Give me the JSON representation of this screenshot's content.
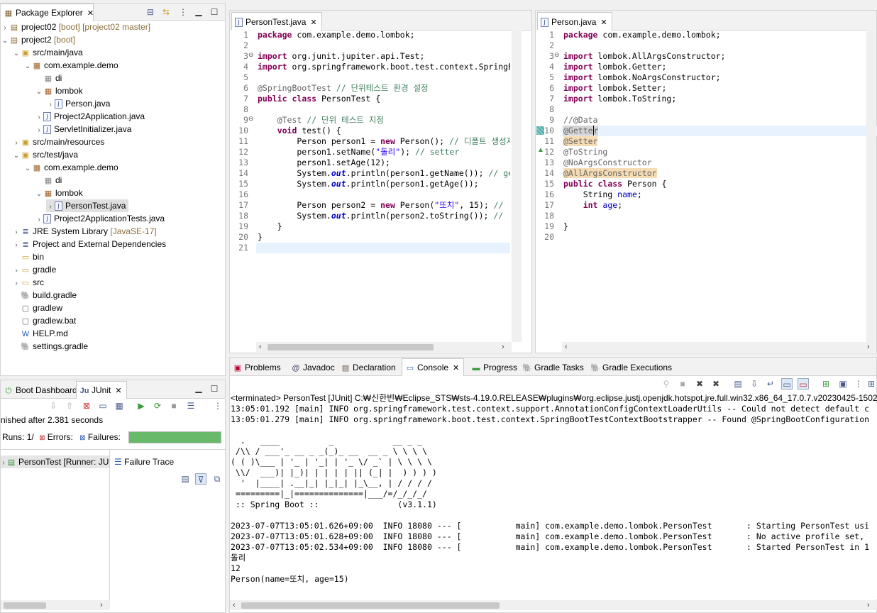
{
  "package_explorer": {
    "tab_label": "Package Explorer",
    "tree": [
      {
        "indent": 0,
        "twisty": "›",
        "icon": "project",
        "label": "project02",
        "suffix": " [boot] [project02 master]"
      },
      {
        "indent": 0,
        "twisty": "⌄",
        "icon": "project",
        "label": "project2",
        "suffix": " [boot]"
      },
      {
        "indent": 1,
        "twisty": "⌄",
        "icon": "srcfolder",
        "label": "src/main/java",
        "suffix": ""
      },
      {
        "indent": 2,
        "twisty": "⌄",
        "icon": "package",
        "label": "com.example.demo",
        "suffix": ""
      },
      {
        "indent": 3,
        "twisty": "",
        "icon": "package-empty",
        "label": "di",
        "suffix": ""
      },
      {
        "indent": 3,
        "twisty": "⌄",
        "icon": "package",
        "label": "lombok",
        "suffix": ""
      },
      {
        "indent": 4,
        "twisty": "›",
        "icon": "java",
        "label": "Person.java",
        "suffix": ""
      },
      {
        "indent": 3,
        "twisty": "›",
        "icon": "java",
        "label": "Project2Application.java",
        "suffix": ""
      },
      {
        "indent": 3,
        "twisty": "›",
        "icon": "java",
        "label": "ServletInitializer.java",
        "suffix": ""
      },
      {
        "indent": 1,
        "twisty": "›",
        "icon": "srcfolder",
        "label": "src/main/resources",
        "suffix": ""
      },
      {
        "indent": 1,
        "twisty": "⌄",
        "icon": "srcfolder",
        "label": "src/test/java",
        "suffix": ""
      },
      {
        "indent": 2,
        "twisty": "⌄",
        "icon": "package",
        "label": "com.example.demo",
        "suffix": ""
      },
      {
        "indent": 3,
        "twisty": "",
        "icon": "package-empty",
        "label": "di",
        "suffix": ""
      },
      {
        "indent": 3,
        "twisty": "⌄",
        "icon": "package",
        "label": "lombok",
        "suffix": ""
      },
      {
        "indent": 4,
        "twisty": "›",
        "icon": "java",
        "label": "PersonTest.java",
        "suffix": "",
        "selected": true
      },
      {
        "indent": 3,
        "twisty": "›",
        "icon": "java",
        "label": "Project2ApplicationTests.java",
        "suffix": ""
      },
      {
        "indent": 1,
        "twisty": "›",
        "icon": "library",
        "label": "JRE System Library",
        "suffix": " [JavaSE-17]"
      },
      {
        "indent": 1,
        "twisty": "›",
        "icon": "library",
        "label": "Project and External Dependencies",
        "suffix": ""
      },
      {
        "indent": 1,
        "twisty": "",
        "icon": "folder",
        "label": "bin",
        "suffix": ""
      },
      {
        "indent": 1,
        "twisty": "›",
        "icon": "folder",
        "label": "gradle",
        "suffix": ""
      },
      {
        "indent": 1,
        "twisty": "›",
        "icon": "folder",
        "label": "src",
        "suffix": ""
      },
      {
        "indent": 1,
        "twisty": "",
        "icon": "gradle",
        "label": "build.gradle",
        "suffix": ""
      },
      {
        "indent": 1,
        "twisty": "",
        "icon": "file",
        "label": "gradlew",
        "suffix": ""
      },
      {
        "indent": 1,
        "twisty": "",
        "icon": "file",
        "label": "gradlew.bat",
        "suffix": ""
      },
      {
        "indent": 1,
        "twisty": "",
        "icon": "web",
        "label": "HELP.md",
        "suffix": ""
      },
      {
        "indent": 1,
        "twisty": "",
        "icon": "gradle",
        "label": "settings.gradle",
        "suffix": ""
      }
    ]
  },
  "junit": {
    "tabs": [
      "Boot Dashboard",
      "JUnit"
    ],
    "finished": "nished after 2.381 seconds",
    "runs_label": "Runs:",
    "runs_value": "1/",
    "errors_label": "Errors:",
    "failures_label": "Failures:",
    "progress": 1.0,
    "result_item": "PersonTest [Runner: JU",
    "failure_trace": "Failure Trace"
  },
  "editor_left": {
    "tab_label": "PersonTest.java",
    "line_numbers": [
      "1",
      "2",
      "3",
      "4",
      "5",
      "6",
      "7",
      "8",
      "9",
      "10",
      "11",
      "12",
      "13",
      "14",
      "15",
      "16",
      "17",
      "18",
      "19",
      "20",
      "21"
    ]
  },
  "editor_right": {
    "tab_label": "Person.java",
    "line_numbers": [
      "1",
      "2",
      "3",
      "4",
      "5",
      "6",
      "7",
      "8",
      "9",
      "10",
      "11",
      "12",
      "13",
      "14",
      "15",
      "16",
      "17",
      "18",
      "19",
      "20"
    ]
  },
  "bottom_tabs": [
    "Problems",
    "Javadoc",
    "Declaration",
    "Console",
    "Progress",
    "Gradle Tasks",
    "Gradle Executions"
  ],
  "console": {
    "header": "<terminated> PersonTest [JUnit] C:₩신한빈₩Eclipse_STS₩sts-4.19.0.RELEASE₩plugins₩org.eclipse.justj.openjdk.hotspot.jre.full.win32.x86_64_17.0.7.v20230425-1502₩jre",
    "lines": [
      "13:05:01.192 [main] INFO org.springframework.test.context.support.AnnotationConfigContextLoaderUtils -- Could not detect default c",
      "13:05:01.279 [main] INFO org.springframework.boot.test.context.SpringBootTestContextBootstrapper -- Found @SpringBootConfiguration",
      "",
      "  .   ____          _            __ _ _",
      " /\\\\ / ___'_ __ _ _(_)_ __  __ _ \\ \\ \\ \\",
      "( ( )\\___ | '_ | '_| | '_ \\/ _` | \\ \\ \\ \\",
      " \\\\/  ___)| |_)| | | | | || (_| |  ) ) ) )",
      "  '  |____| .__|_| |_|_| |_\\__, | / / / /",
      " =========|_|==============|___/=/_/_/_/",
      " :: Spring Boot ::                (v3.1.1)",
      "",
      "2023-07-07T13:05:01.626+09:00  INFO 18080 --- [           main] com.example.demo.lombok.PersonTest       : Starting PersonTest usi",
      "2023-07-07T13:05:01.628+09:00  INFO 18080 --- [           main] com.example.demo.lombok.PersonTest       : No active profile set,",
      "2023-07-07T13:05:02.534+09:00  INFO 18080 --- [           main] com.example.demo.lombok.PersonTest       : Started PersonTest in 1",
      "돌리",
      "12",
      "Person(name=또치, age=15)"
    ]
  }
}
